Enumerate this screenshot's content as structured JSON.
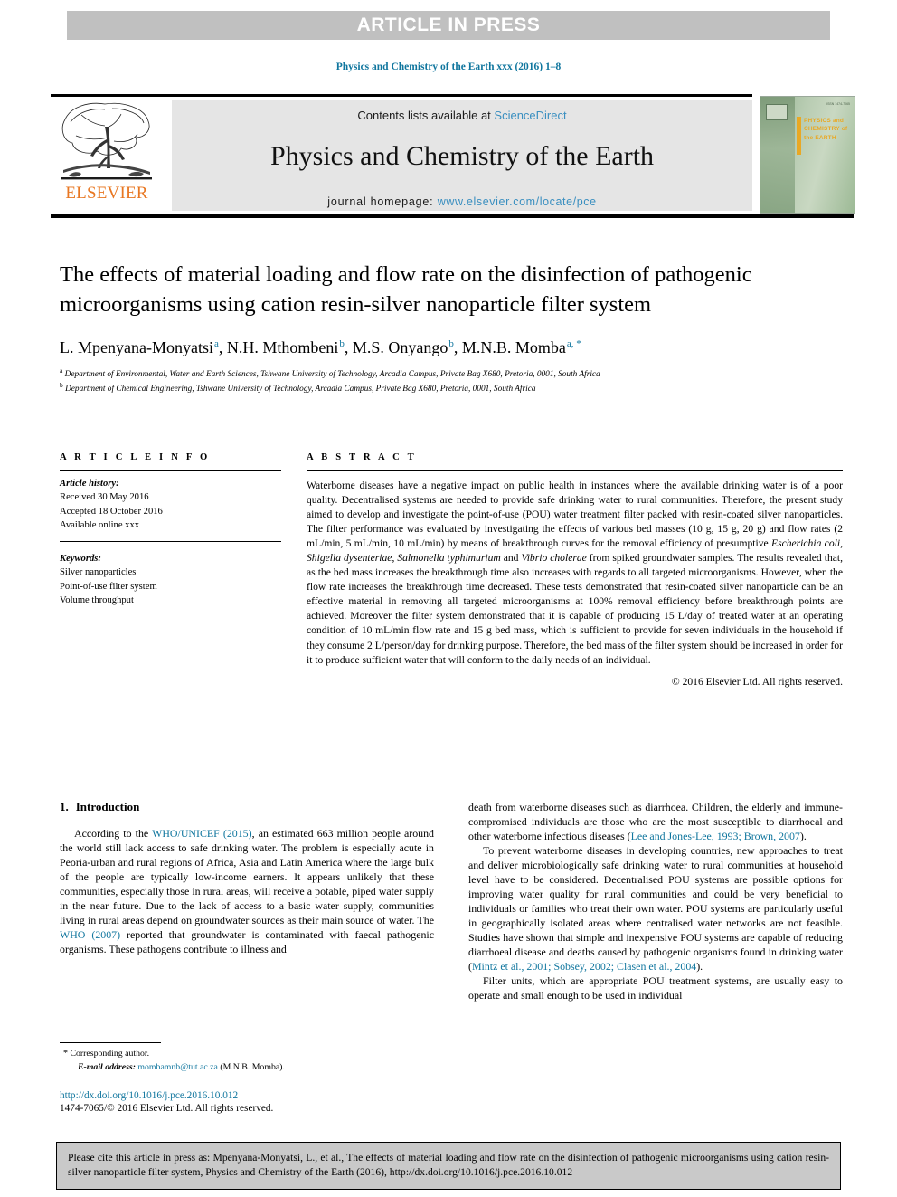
{
  "banner": {
    "label": "ARTICLE IN PRESS"
  },
  "running_head": "Physics and Chemistry of the Earth xxx (2016) 1–8",
  "masthead": {
    "contents_prefix": "Contents lists available at ",
    "contents_link": "ScienceDirect",
    "journal_title": "Physics and Chemistry of the Earth",
    "homepage_prefix": "journal homepage: ",
    "homepage_link": "www.elsevier.com/locate/pce",
    "publisher_wordmark": "ELSEVIER",
    "publisher_logo_icon": "elsevier-tree-icon",
    "cover_title": "PHYSICS and CHEMISTRY of the EARTH",
    "cover_corner_text": "ISSN 1474-7065",
    "accent_link_color": "#3a8fc0",
    "elsevier_orange": "#e87722"
  },
  "article": {
    "title": "The effects of material loading and flow rate on the disinfection of pathogenic microorganisms using cation resin-silver nanoparticle filter system",
    "authors": [
      {
        "name": "L. Mpenyana-Monyatsi",
        "marks": "a"
      },
      {
        "name": "N.H. Mthombeni",
        "marks": "b"
      },
      {
        "name": "M.S. Onyango",
        "marks": "b"
      },
      {
        "name": "M.N.B. Momba",
        "marks": "a, *"
      }
    ],
    "affiliations": [
      {
        "mark": "a",
        "text": "Department of Environmental, Water and Earth Sciences, Tshwane University of Technology, Arcadia Campus, Private Bag X680, Pretoria, 0001, South Africa"
      },
      {
        "mark": "b",
        "text": "Department of Chemical Engineering, Tshwane University of Technology, Arcadia Campus, Private Bag X680, Pretoria, 0001, South Africa"
      }
    ]
  },
  "article_info": {
    "heading": "A R T I C L E  I N F O",
    "history_label": "Article history:",
    "history": [
      "Received 30 May 2016",
      "Accepted 18 October 2016",
      "Available online xxx"
    ],
    "keywords_label": "Keywords:",
    "keywords": [
      "Silver nanoparticles",
      "Point-of-use filter system",
      "Volume throughput"
    ]
  },
  "abstract": {
    "heading": "A B S T R A C T",
    "paragraph_1": "Waterborne diseases have a negative impact on public health in instances where the available drinking water is of a poor quality. Decentralised systems are needed to provide safe drinking water to rural communities. Therefore, the present study aimed to develop and investigate the point-of-use (POU) water treatment filter packed with resin-coated silver nanoparticles. The filter performance was evaluated by investigating the effects of various bed masses (10 g, 15 g, 20 g) and flow rates (2 mL/min, 5 mL/min, 10 mL/min) by means of breakthrough curves for the removal efficiency of presumptive ",
    "species_1": "Escherichia coli",
    "sep_1": ", ",
    "species_2": "Shigella dysenteriae",
    "sep_2": ", ",
    "species_3": "Salmonella typhimurium",
    "sep_3": " and ",
    "species_4": "Vibrio cholerae",
    "paragraph_2": " from spiked groundwater samples. The results revealed that, as the bed mass increases the breakthrough time also increases with regards to all targeted microorganisms. However, when the flow rate increases the breakthrough time decreased. These tests demonstrated that resin-coated silver nanoparticle can be an effective material in removing all targeted microorganisms at 100% removal efficiency before breakthrough points are achieved. Moreover the filter system demonstrated that it is capable of producing 15 L/day of treated water at an operating condition of 10 mL/min flow rate and 15 g bed mass, which is sufficient to provide for seven individuals in the household if they consume 2 L/person/day for drinking purpose. Therefore, the bed mass of the filter system should be increased in order for it to produce sufficient water that will conform to the daily needs of an individual.",
    "copyright": "© 2016 Elsevier Ltd. All rights reserved."
  },
  "introduction": {
    "number": "1.",
    "heading": "Introduction",
    "left": {
      "p1_a": "According to the ",
      "p1_cite1": "WHO/UNICEF (2015)",
      "p1_b": ", an estimated 663 million people around the world still lack access to safe drinking water. The problem is especially acute in Peoria-urban and rural regions of Africa, Asia and Latin America where the large bulk of the people are typically low-income earners. It appears unlikely that these communities, especially those in rural areas, will receive a potable, piped water supply in the near future. Due to the lack of access to a basic water supply, communities living in rural areas depend on groundwater sources as their main source of water. The ",
      "p1_cite2": "WHO (2007)",
      "p1_c": " reported that groundwater is contaminated with faecal pathogenic organisms. These pathogens contribute to illness and"
    },
    "right": {
      "p1_a": "death from waterborne diseases such as diarrhoea. Children, the elderly and immune-compromised individuals are those who are the most susceptible to diarrhoeal and other waterborne infectious diseases (",
      "p1_cite1": "Lee and Jones-Lee, 1993; Brown, 2007",
      "p1_b": ").",
      "p2_a": "To prevent waterborne diseases in developing countries, new approaches to treat and deliver microbiologically safe drinking water to rural communities at household level have to be considered. Decentralised POU systems are possible options for improving water quality for rural communities and could be very beneficial to individuals or families who treat their own water. POU systems are particularly useful in geographically isolated areas where centralised water networks are not feasible. Studies have shown that simple and inexpensive POU systems are capable of reducing diarrhoeal disease and deaths caused by pathogenic organisms found in drinking water (",
      "p2_cite1": "Mintz et al., 2001; Sobsey, 2002; Clasen et al., 2004",
      "p2_b": ").",
      "p3": "Filter units, which are appropriate POU treatment systems, are usually easy to operate and small enough to be used in individual"
    }
  },
  "footnote": {
    "star": "*",
    "corresponding": "Corresponding author.",
    "email_label": "E-mail address:",
    "email": "mombamnb@tut.ac.za",
    "email_owner": "(M.N.B. Momba)."
  },
  "doi": {
    "url": "http://dx.doi.org/10.1016/j.pce.2016.10.012",
    "issn_line": "1474-7065/© 2016 Elsevier Ltd. All rights reserved."
  },
  "cite_box": {
    "text": "Please cite this article in press as: Mpenyana-Monyatsi, L., et al., The effects of material loading and flow rate on the disinfection of pathogenic microorganisms using cation resin-silver nanoparticle filter system, Physics and Chemistry of the Earth (2016), http://dx.doi.org/10.1016/j.pce.2016.10.012"
  }
}
